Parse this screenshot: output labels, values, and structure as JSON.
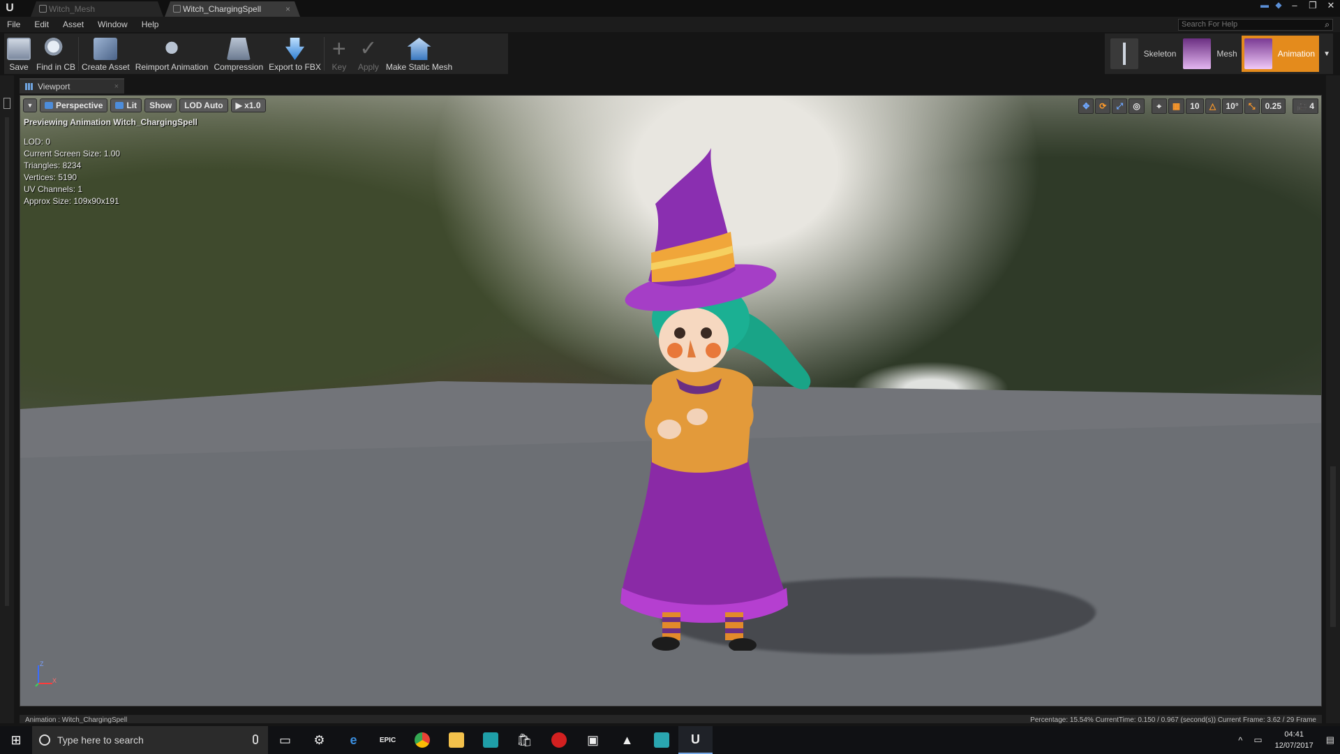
{
  "titlebar": {
    "tabs": [
      {
        "label": "Witch_Mesh"
      },
      {
        "label": "Witch_ChargingSpell"
      }
    ]
  },
  "menu": [
    "File",
    "Edit",
    "Asset",
    "Window",
    "Help"
  ],
  "help_search": {
    "placeholder": "Search For Help"
  },
  "toolbar": [
    {
      "label": "Save",
      "icon": "save-icon"
    },
    {
      "label": "Find in CB",
      "icon": "find-icon"
    },
    {
      "label": "Create Asset",
      "icon": "create-asset-icon"
    },
    {
      "label": "Reimport Animation",
      "icon": "reimport-icon"
    },
    {
      "label": "Compression",
      "icon": "compression-icon"
    },
    {
      "label": "Export to FBX",
      "icon": "export-icon"
    },
    {
      "label": "Key",
      "icon": "key-icon",
      "disabled": true
    },
    {
      "label": "Apply",
      "icon": "apply-icon",
      "disabled": true
    },
    {
      "label": "Make Static Mesh",
      "icon": "static-mesh-icon"
    }
  ],
  "modes": [
    {
      "label": "Skeleton"
    },
    {
      "label": "Mesh"
    },
    {
      "label": "Animation",
      "active": true
    }
  ],
  "viewport": {
    "tab_label": "Viewport",
    "buttons": {
      "perspective": "Perspective",
      "lit": "Lit",
      "show": "Show",
      "lod": "LOD Auto",
      "speed": "x1.0"
    },
    "snap": {
      "grid": "10",
      "rotation": "10°",
      "scale": "0.25",
      "camera_speed": "4"
    },
    "preview_title": "Previewing Animation Witch_ChargingSpell",
    "stats": [
      "LOD: 0",
      "Current Screen Size: 1.00",
      "Triangles: 8234",
      "Vertices: 5190",
      "UV Channels: 1",
      "Approx Size: 109x90x191"
    ],
    "axis": {
      "z": "Z",
      "x": "X"
    }
  },
  "statusbar": {
    "left": "Animation : Witch_ChargingSpell",
    "right": "Percentage: 15.54% CurrentTime: 0.150 / 0.967 (second(s)) Current Frame: 3.62 / 29 Frame"
  },
  "taskbar": {
    "search_placeholder": "Type here to search",
    "clock_time": "04:41",
    "clock_date": "12/07/2017",
    "epic_label": "EPIC"
  },
  "colors": {
    "accent_orange": "#e48b1c",
    "hat_purple": "#8e3bb0",
    "hair_teal": "#1aa58a",
    "shirt_orange": "#e39a3a"
  }
}
